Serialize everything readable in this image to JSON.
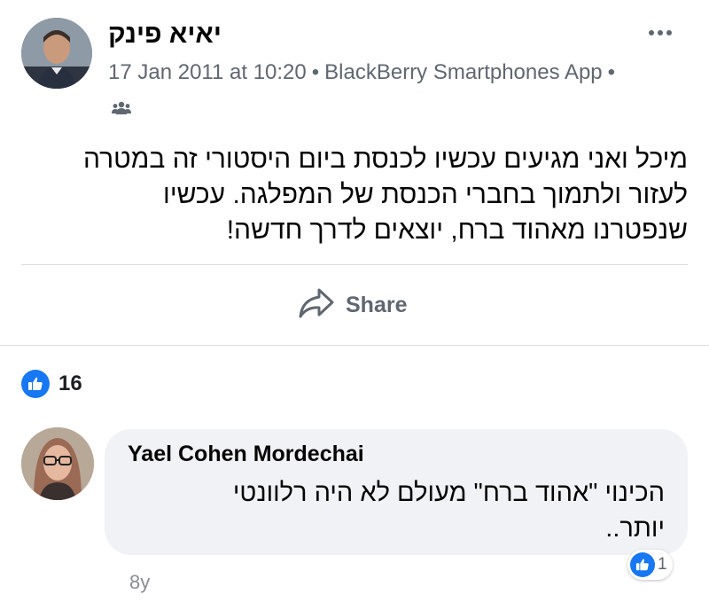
{
  "post": {
    "author": "יאיא פינק",
    "timestamp": "17 Jan 2011 at 10:20",
    "source": "BlackBerry Smartphones App",
    "audience_icon": "friends-icon",
    "text_lines": [
      "מיכל ואני מגיעים עכשיו לכנסת ביום היסטורי זה במטרה",
      "לעזור ולתמוך בחברי הכנסת של המפלגה. עכשיו",
      "שנפטרנו מאהוד ברח, יוצאים לדרך חדשה!"
    ],
    "share_label": "Share",
    "reaction_count": "16",
    "colors": {
      "like_blue": "#1877f2",
      "meta_gray": "#606770",
      "bubble_bg": "#f0f2f5"
    }
  },
  "comment": {
    "author": "Yael Cohen Mordechai",
    "text_lines": [
      "הכינוי \"אהוד ברח\" מעולם לא היה רלוונטי",
      "יותר.."
    ],
    "reaction_count": "1",
    "time": "8y"
  }
}
